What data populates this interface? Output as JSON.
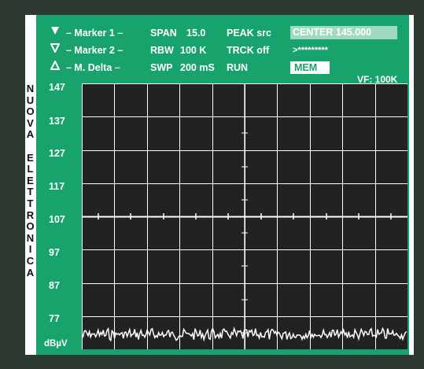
{
  "header": {
    "marker1": "– Marker 1 –",
    "marker2": "– Marker 2 –",
    "delta": "– M. Delta –",
    "span": "SPAN",
    "span_value": "15.0",
    "rbw": "RBW",
    "rbw_value": "100 K",
    "swp": "SWP",
    "swp_value": "200 mS",
    "peak_src": "PEAK src",
    "trck_off": "TRCK  off",
    "run": "RUN",
    "center": "CENTER  145.000",
    "stars": ">*********",
    "mem": "MEM",
    "vf": "VF: 100K"
  },
  "side_label": [
    "N",
    "U",
    "O",
    "V",
    "A",
    "",
    "E",
    "L",
    "E",
    "T",
    "T",
    "R",
    "O",
    "N",
    "I",
    "C",
    "A"
  ],
  "y_axis": {
    "ticks": [
      "147",
      "137",
      "127",
      "117",
      "107",
      "97",
      "87",
      "77"
    ],
    "unit": "dBµV"
  },
  "colors": {
    "panel": "#18a26c",
    "center_box": "#9fd9bf",
    "grid": "#ffffff",
    "plot_bg": "#222222"
  }
}
